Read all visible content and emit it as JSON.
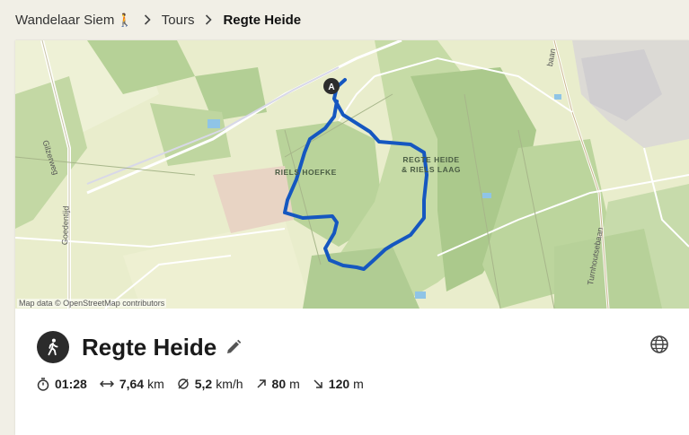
{
  "breadcrumb": {
    "user": "Wandelaar Siem",
    "user_emoji": "🚶",
    "tours": "Tours",
    "current": "Regte Heide"
  },
  "map": {
    "attribution": "Map data © OpenStreetMap contributors",
    "labels": {
      "area1": "RIELS HOEFKE",
      "area2_line1": "REGTE HEIDE",
      "area2_line2": "& RIELS LAAG",
      "road_gilze": "Gilzerweg",
      "road_goed": "Goedentijd",
      "road_turn": "Turnhoutsebaan",
      "road_baan": "baan"
    },
    "start_marker": "A",
    "route_color": "#1557c0"
  },
  "tour": {
    "title": "Regte Heide",
    "activity_icon": "hiking-icon"
  },
  "stats": {
    "duration": "01:28",
    "distance_value": "7,64",
    "distance_unit": "km",
    "speed_value": "5,2",
    "speed_unit": "km/h",
    "ascent_value": "80",
    "ascent_unit": "m",
    "descent_value": "120",
    "descent_unit": "m"
  }
}
